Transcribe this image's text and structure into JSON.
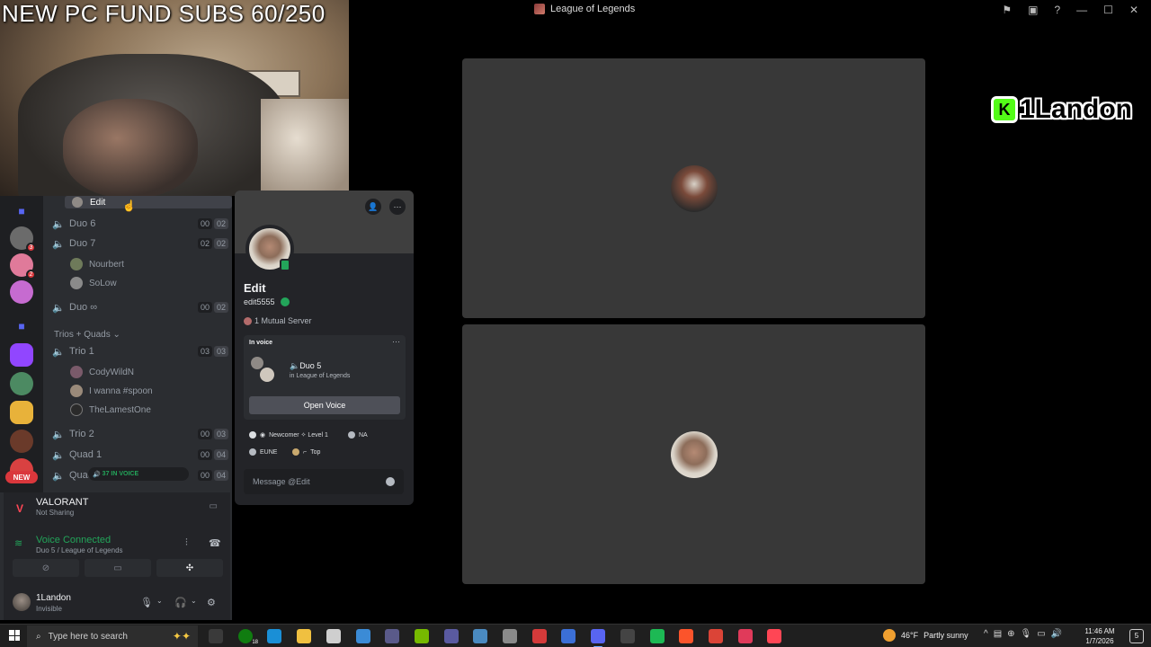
{
  "window": {
    "title": "League of Legends",
    "controls": [
      "flag-icon",
      "screen-icon",
      "help-icon",
      "minimize-icon",
      "maximize-icon",
      "close-icon"
    ]
  },
  "overlay": {
    "banner_text": "NEW PC FUND SUBS 60/250",
    "streamer_logo_letter": "K",
    "streamer_name": "1Landon"
  },
  "voice_tiles": [
    {
      "avatar": "user-avatar-1"
    },
    {
      "avatar": "user-avatar-2"
    }
  ],
  "sidebar": {
    "new_pill": "NEW",
    "servers": [
      {
        "icon": "folder-icon",
        "color": "#5865f2"
      },
      {
        "icon": "server-avatar",
        "color": "#6b6b6b",
        "badge": "3"
      },
      {
        "icon": "server-avatar",
        "color": "#e07a9a",
        "badge": "2"
      },
      {
        "icon": "server-avatar",
        "color": "#c66bd0"
      },
      {
        "icon": "folder-icon",
        "color": "#5865f2"
      },
      {
        "icon": "twitch-icon",
        "color": "#9146ff"
      },
      {
        "icon": "server-avatar",
        "color": "#4c8a62"
      },
      {
        "icon": "server-avatar",
        "color": "#e8b23a"
      },
      {
        "icon": "server-avatar",
        "color": "#6a3a2a"
      },
      {
        "icon": "server-avatar",
        "color": "#d94141"
      }
    ]
  },
  "channels": {
    "edit_row": "Edit",
    "duo6": {
      "name": "Duo 6",
      "c1": "00",
      "c2": "02"
    },
    "duo7": {
      "name": "Duo 7",
      "c1": "02",
      "c2": "02"
    },
    "duo7_members": [
      "Nourbert",
      "SoLow"
    ],
    "duoinf": {
      "name": "Duo ∞",
      "c1": "00",
      "c2": "02"
    },
    "category": "Trios + Quads",
    "trio1": {
      "name": "Trio 1",
      "c1": "03",
      "c2": "03"
    },
    "trio1_members": [
      "CodyWildN",
      "I wanna #spoon",
      "TheLamestOne"
    ],
    "trio2": {
      "name": "Trio 2",
      "c1": "00",
      "c2": "03"
    },
    "quad1": {
      "name": "Quad 1",
      "c1": "00",
      "c2": "04"
    },
    "quad2": {
      "name": "Quad",
      "c1": "00",
      "c2": "04"
    },
    "in_voice_pill": "37 IN VOICE"
  },
  "activity": {
    "title": "VALORANT",
    "subtitle": "Not Sharing"
  },
  "voice": {
    "title": "Voice Connected",
    "subtitle": "Duo 5 / League of Legends"
  },
  "user": {
    "name": "1Landon",
    "status": "Invisible"
  },
  "profile": {
    "display_name": "Edit",
    "handle": "edit5555",
    "mutual": "1 Mutual Server",
    "in_voice_label": "In voice",
    "channel": "Duo 5",
    "channel_game": "in League of Legends",
    "open_voice": "Open Voice",
    "tags": [
      {
        "label": "Newcomer ✧ Level 1"
      },
      {
        "label": "NA"
      },
      {
        "label": "EUNE"
      },
      {
        "label": "Top"
      }
    ],
    "message_placeholder": "Message @Edit"
  },
  "taskbar": {
    "search_placeholder": "Type here to search",
    "weather_temp": "46°F",
    "weather_text": "Partly sunny",
    "time": "11:46 AM",
    "date": "1/7/2026",
    "notification_count": "5",
    "xbox_badge": "18",
    "apps": [
      {
        "icon": "task-view-icon",
        "color": "#3a3a3a"
      },
      {
        "icon": "xbox-icon",
        "color": "#107c10"
      },
      {
        "icon": "edge-icon",
        "color": "#1a8fd6"
      },
      {
        "icon": "file-explorer-icon",
        "color": "#f0c040"
      },
      {
        "icon": "app-icon",
        "color": "#cfcfcf"
      },
      {
        "icon": "store-icon",
        "color": "#3b8bd6"
      },
      {
        "icon": "app-icon",
        "color": "#5a5a8a"
      },
      {
        "icon": "nvidia-icon",
        "color": "#76b900"
      },
      {
        "icon": "media-icon",
        "color": "#5a5aa0"
      },
      {
        "icon": "calculator-icon",
        "color": "#4a8ac0"
      },
      {
        "icon": "settings-icon",
        "color": "#8a8a8a"
      },
      {
        "icon": "app-icon",
        "color": "#d43a3a"
      },
      {
        "icon": "app-icon",
        "color": "#3b6fd6"
      },
      {
        "icon": "discord-icon",
        "color": "#5865f2"
      },
      {
        "icon": "app-icon",
        "color": "#444444"
      },
      {
        "icon": "spotify-icon",
        "color": "#1db954"
      },
      {
        "icon": "brave-icon",
        "color": "#fb542b"
      },
      {
        "icon": "chrome-icon",
        "color": "#db4437"
      },
      {
        "icon": "app-icon",
        "color": "#e03a5a"
      },
      {
        "icon": "valorant-icon",
        "color": "#ff4655"
      }
    ]
  }
}
